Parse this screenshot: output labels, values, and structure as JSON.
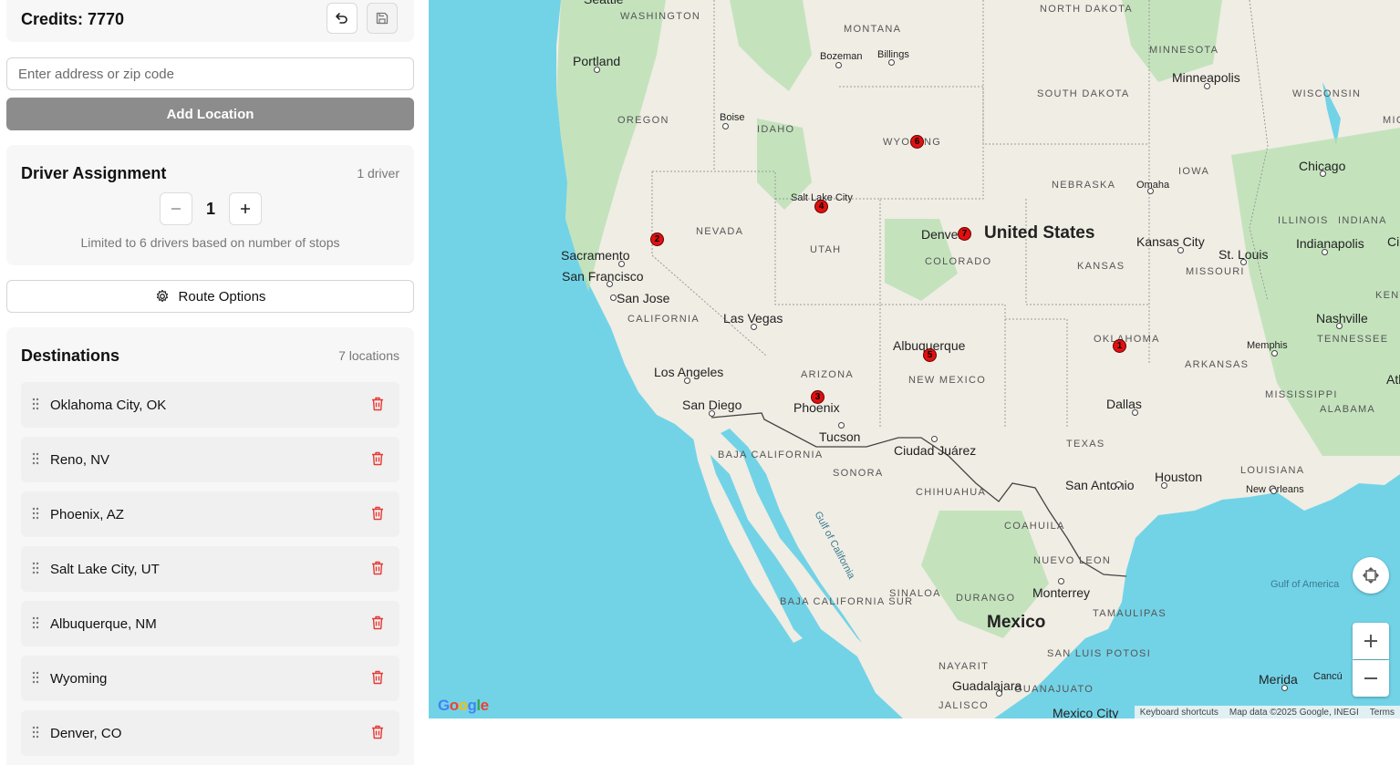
{
  "credits": {
    "label": "Credits: 7770"
  },
  "address": {
    "placeholder": "Enter address or zip code"
  },
  "add_location": {
    "label": "Add Location"
  },
  "drivers": {
    "title": "Driver Assignment",
    "count_label": "1 driver",
    "value": "1",
    "limit_text": "Limited to 6 drivers based on number of stops"
  },
  "route_options": {
    "label": "Route Options"
  },
  "destinations": {
    "title": "Destinations",
    "count_label": "7 locations",
    "items": [
      {
        "label": "Oklahoma City, OK"
      },
      {
        "label": "Reno, NV"
      },
      {
        "label": "Phoenix, AZ"
      },
      {
        "label": "Salt Lake City, UT"
      },
      {
        "label": "Albuquerque, NM"
      },
      {
        "label": "Wyoming"
      },
      {
        "label": "Denver, CO"
      }
    ]
  },
  "map": {
    "markers": [
      "1",
      "2",
      "3",
      "4",
      "5",
      "6",
      "7"
    ],
    "countries": [
      "United States",
      "Mexico"
    ],
    "states": [
      "WASHINGTON",
      "MONTANA",
      "NORTH DAKOTA",
      "MINNESOTA",
      "OREGON",
      "IDAHO",
      "SOUTH DAKOTA",
      "WISCONSIN",
      "WYOMING",
      "IOWA",
      "NEBRASKA",
      "NEVADA",
      "UTAH",
      "COLORADO",
      "KANSAS",
      "MISSOURI",
      "ILLINOIS",
      "INDIANA",
      "KENTUCKY",
      "CALIFORNIA",
      "ARIZONA",
      "NEW MEXICO",
      "OKLAHOMA",
      "ARKANSAS",
      "TENNESSEE",
      "MISSISSIPPI",
      "ALABAMA",
      "TEXAS",
      "LOUISIANA",
      "BAJA CALIFORNIA",
      "SONORA",
      "CHIHUAHUA",
      "COAHUILA",
      "NUEVO LEON",
      "SINALOA",
      "DURANGO",
      "TAMAULIPAS",
      "BAJA CALIFORNIA SUR",
      "NAYARIT",
      "SAN LUIS POTOSI",
      "GUANAJUATO",
      "JALISCO",
      "MICHIG"
    ],
    "cities": [
      "Seattle",
      "Portland",
      "Bozeman",
      "Billings",
      "Boise",
      "Minneapolis",
      "Omaha",
      "Chicago",
      "Salt Lake City",
      "Denver",
      "Sacramento",
      "San Francisco",
      "San Jose",
      "Las Vegas",
      "Kansas City",
      "St. Louis",
      "Indianapolis",
      "Cincin",
      "Nashville",
      "Memphis",
      "Albuquerque",
      "Los Angeles",
      "San Diego",
      "Phoenix",
      "Tucson",
      "Ciudad Juárez",
      "Dallas",
      "Atlan",
      "San Antonio",
      "Houston",
      "New Orleans",
      "Monterrey",
      "Guadalajara",
      "Mexico City",
      "Merida",
      "Cancú"
    ],
    "water": [
      "Gulf of California",
      "Gulf of America"
    ],
    "footer": {
      "shortcuts": "Keyboard shortcuts",
      "mapdata": "Map data ©2025 Google, INEGI",
      "terms": "Terms"
    },
    "logo": "Google"
  }
}
